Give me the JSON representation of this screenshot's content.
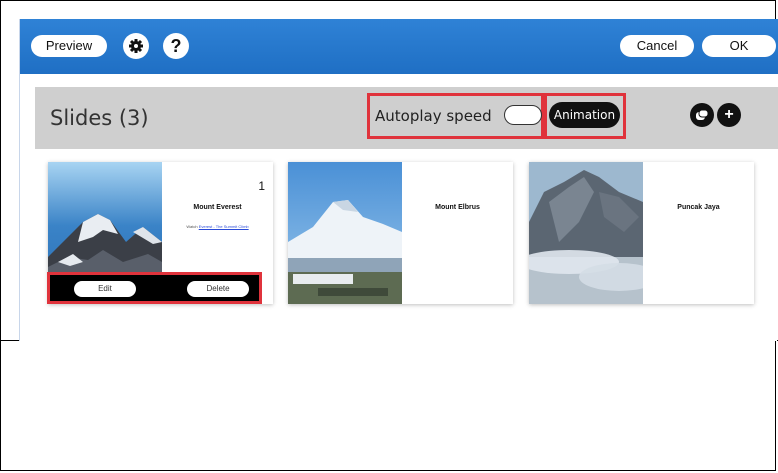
{
  "toolbar": {
    "preview_label": "Preview",
    "settings_icon": "gear-icon",
    "help_label": "?",
    "cancel_label": "Cancel",
    "ok_label": "OK"
  },
  "header": {
    "title": "Slides (3)",
    "autoplay_label": "Autoplay speed",
    "animation_label": "Animation",
    "add_label": "+"
  },
  "slides": [
    {
      "number": "1",
      "title": "Mount Everest",
      "link_prefix": "Watch",
      "link_text": "Everest - The Summit Climb"
    },
    {
      "title": "Mount Elbrus"
    },
    {
      "title": "Puncak Jaya"
    }
  ],
  "slide_actions": {
    "edit_label": "Edit",
    "delete_label": "Delete"
  },
  "colors": {
    "accent_blue": "#2f82d6",
    "highlight_red": "#e0333c",
    "header_gray": "#cfcfcf"
  }
}
